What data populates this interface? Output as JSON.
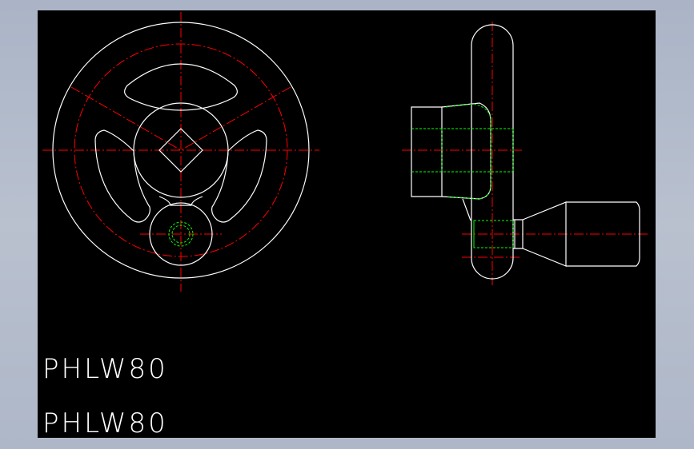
{
  "drawing": {
    "labels": [
      "PHLW80",
      "PHLW80"
    ],
    "colors": {
      "background": "#000000",
      "outline": "#ffffff",
      "centerline": "#ff0000",
      "hidden": "#00ff00",
      "frame": "#aab4c6"
    }
  }
}
